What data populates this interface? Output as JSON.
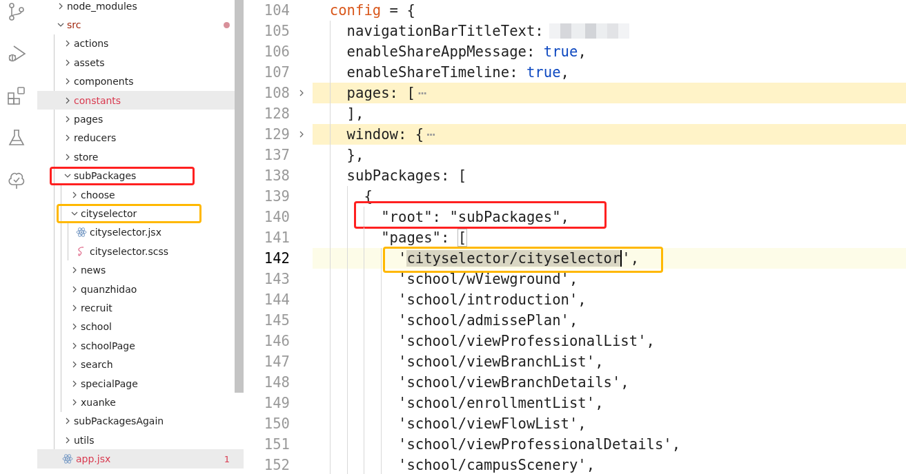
{
  "activity_bar": [
    {
      "kind": "source-control"
    },
    {
      "kind": "run-debug"
    },
    {
      "kind": "extensions"
    },
    {
      "kind": "testing"
    },
    {
      "kind": "tree"
    }
  ],
  "explorer": {
    "items": [
      {
        "label": "node_modules",
        "kind": "folder",
        "expanded": false,
        "selected": false,
        "error": false,
        "problem_dot": false
      },
      {
        "label": "src",
        "kind": "folder",
        "expanded": true,
        "selected": false,
        "error": true,
        "problem_dot": true,
        "children": [
          {
            "label": "actions",
            "kind": "folder",
            "expanded": false,
            "selected": false,
            "error": false,
            "problem_dot": false
          },
          {
            "label": "assets",
            "kind": "folder",
            "expanded": false,
            "selected": false,
            "error": false,
            "problem_dot": false
          },
          {
            "label": "components",
            "kind": "folder",
            "expanded": false,
            "selected": false,
            "error": false,
            "problem_dot": false
          },
          {
            "label": "constants",
            "kind": "folder",
            "expanded": false,
            "selected": true,
            "error": true,
            "problem_dot": false
          },
          {
            "label": "pages",
            "kind": "folder",
            "expanded": false,
            "selected": false,
            "error": false,
            "problem_dot": false
          },
          {
            "label": "reducers",
            "kind": "folder",
            "expanded": false,
            "selected": false,
            "error": false,
            "problem_dot": false
          },
          {
            "label": "store",
            "kind": "folder",
            "expanded": false,
            "selected": false,
            "error": false,
            "problem_dot": false
          },
          {
            "label": "subPackages",
            "kind": "folder",
            "expanded": true,
            "selected": false,
            "error": false,
            "problem_dot": false,
            "frame": {
              "color": "#ff2020"
            },
            "children": [
              {
                "label": "choose",
                "kind": "folder",
                "expanded": false,
                "selected": false,
                "error": false,
                "problem_dot": false
              },
              {
                "label": "cityselector",
                "kind": "folder",
                "expanded": true,
                "selected": false,
                "error": false,
                "problem_dot": false,
                "frame": {
                  "color": "#ffb800"
                },
                "children": [
                  {
                    "label": "cityselector.jsx",
                    "kind": "react-file",
                    "selected": false,
                    "error": false,
                    "problem_dot": false
                  },
                  {
                    "label": "cityselector.scss",
                    "kind": "sass-file",
                    "selected": false,
                    "error": false,
                    "problem_dot": false
                  }
                ]
              },
              {
                "label": "news",
                "kind": "folder",
                "expanded": false,
                "selected": false,
                "error": false,
                "problem_dot": false
              },
              {
                "label": "quanzhidao",
                "kind": "folder",
                "expanded": false,
                "selected": false,
                "error": false,
                "problem_dot": false
              },
              {
                "label": "recruit",
                "kind": "folder",
                "expanded": false,
                "selected": false,
                "error": false,
                "problem_dot": false
              },
              {
                "label": "school",
                "kind": "folder",
                "expanded": false,
                "selected": false,
                "error": false,
                "problem_dot": false
              },
              {
                "label": "schoolPage",
                "kind": "folder",
                "expanded": false,
                "selected": false,
                "error": false,
                "problem_dot": false
              },
              {
                "label": "search",
                "kind": "folder",
                "expanded": false,
                "selected": false,
                "error": false,
                "problem_dot": false
              },
              {
                "label": "specialPage",
                "kind": "folder",
                "expanded": false,
                "selected": false,
                "error": false,
                "problem_dot": false
              },
              {
                "label": "xuanke",
                "kind": "folder",
                "expanded": false,
                "selected": false,
                "error": false,
                "problem_dot": false
              }
            ]
          },
          {
            "label": "subPackagesAgain",
            "kind": "folder",
            "expanded": false,
            "selected": false,
            "error": false,
            "problem_dot": false
          },
          {
            "label": "utils",
            "kind": "folder",
            "expanded": false,
            "selected": false,
            "error": false,
            "problem_dot": false
          },
          {
            "label": "app.jsx",
            "kind": "react-file",
            "selected": true,
            "error": true,
            "problem_dot": false,
            "badge": "1"
          }
        ]
      }
    ]
  },
  "editor": {
    "lines": [
      {
        "number": "104",
        "current": false,
        "tokens": [
          {
            "text": "  config",
            "kind": "keyword"
          },
          {
            "text": " = {",
            "kind": "plain"
          }
        ]
      },
      {
        "number": "105",
        "current": false,
        "tokens": [
          {
            "text": "    navigationBarTitleText:",
            "kind": "plain"
          }
        ],
        "redacted": true
      },
      {
        "number": "106",
        "current": false,
        "tokens": [
          {
            "text": "    enableShareAppMessage: ",
            "kind": "plain"
          },
          {
            "text": "true",
            "kind": "boolean"
          },
          {
            "text": ",",
            "kind": "plain"
          }
        ]
      },
      {
        "number": "107",
        "current": false,
        "tokens": [
          {
            "text": "    enableShareTimeline: ",
            "kind": "plain"
          },
          {
            "text": "true",
            "kind": "boolean"
          },
          {
            "text": ",",
            "kind": "plain"
          }
        ]
      },
      {
        "number": "108",
        "current": false,
        "folded": true,
        "tokens": [
          {
            "text": "    pages: [",
            "kind": "plain"
          },
          {
            "text": "⋯",
            "kind": "ellipsis"
          }
        ]
      },
      {
        "number": "128",
        "current": false,
        "tokens": [
          {
            "text": "    ],",
            "kind": "plain"
          }
        ]
      },
      {
        "number": "129",
        "current": false,
        "folded": true,
        "tokens": [
          {
            "text": "    window: {",
            "kind": "plain"
          },
          {
            "text": "⋯",
            "kind": "ellipsis"
          }
        ]
      },
      {
        "number": "137",
        "current": false,
        "tokens": [
          {
            "text": "    },",
            "kind": "plain"
          }
        ]
      },
      {
        "number": "138",
        "current": false,
        "tokens": [
          {
            "text": "    subPackages: [",
            "kind": "plain"
          }
        ]
      },
      {
        "number": "139",
        "current": false,
        "tokens": [
          {
            "text": "      {",
            "kind": "plain"
          }
        ]
      },
      {
        "number": "140",
        "current": false,
        "frame": {
          "color": "#ff2020"
        },
        "tokens": [
          {
            "text": "        \"root\": \"subPackages\",",
            "kind": "plain"
          }
        ]
      },
      {
        "number": "141",
        "current": false,
        "tokens": [
          {
            "text": "        \"pages\": ",
            "kind": "plain"
          },
          {
            "text": "[",
            "kind": "bracket-match"
          }
        ]
      },
      {
        "number": "142",
        "current": true,
        "frame": {
          "color": "#ffb800"
        },
        "tokens": [
          {
            "text": "          '",
            "kind": "plain"
          },
          {
            "text": "cityselector/cityselector",
            "kind": "selected"
          },
          {
            "text": "',",
            "kind": "plain"
          }
        ]
      },
      {
        "number": "143",
        "current": false,
        "tokens": [
          {
            "text": "          'school/wViewground',",
            "kind": "plain"
          }
        ]
      },
      {
        "number": "144",
        "current": false,
        "tokens": [
          {
            "text": "          'school/introduction',",
            "kind": "plain"
          }
        ]
      },
      {
        "number": "145",
        "current": false,
        "tokens": [
          {
            "text": "          'school/admissePlan',",
            "kind": "plain"
          }
        ]
      },
      {
        "number": "146",
        "current": false,
        "tokens": [
          {
            "text": "          'school/viewProfessionalList',",
            "kind": "plain"
          }
        ]
      },
      {
        "number": "147",
        "current": false,
        "tokens": [
          {
            "text": "          'school/viewBranchList',",
            "kind": "plain"
          }
        ]
      },
      {
        "number": "148",
        "current": false,
        "tokens": [
          {
            "text": "          'school/viewBranchDetails',",
            "kind": "plain"
          }
        ]
      },
      {
        "number": "149",
        "current": false,
        "tokens": [
          {
            "text": "          'school/enrollmentList',",
            "kind": "plain"
          }
        ]
      },
      {
        "number": "150",
        "current": false,
        "tokens": [
          {
            "text": "          'school/viewFlowList',",
            "kind": "plain"
          }
        ]
      },
      {
        "number": "151",
        "current": false,
        "tokens": [
          {
            "text": "          'school/viewProfessionalDetails',",
            "kind": "plain"
          }
        ]
      },
      {
        "number": "152",
        "current": false,
        "tokens": [
          {
            "text": "          'school/campusScenery',",
            "kind": "plain"
          }
        ]
      }
    ]
  }
}
